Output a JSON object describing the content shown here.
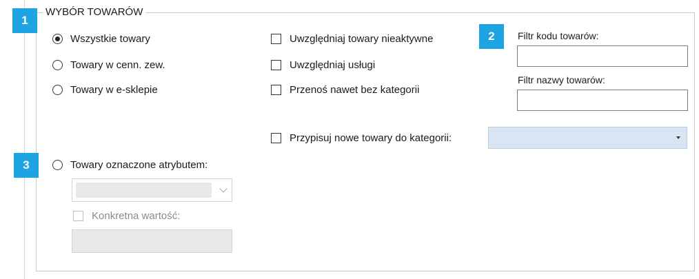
{
  "group_title": "WYBÓR TOWARÓW",
  "badges": [
    "1",
    "2",
    "3"
  ],
  "radios": [
    {
      "label": "Wszystkie towary",
      "checked": true
    },
    {
      "label": "Towary w cenn. zew.",
      "checked": false
    },
    {
      "label": "Towary w e-sklepie",
      "checked": false
    },
    {
      "label": "Towary oznaczone atrybutem:",
      "checked": false
    }
  ],
  "checkboxes": [
    {
      "label": "Uwzględniaj towary nieaktywne",
      "checked": false
    },
    {
      "label": "Uwzględniaj usługi",
      "checked": false
    },
    {
      "label": "Przenoś nawet bez kategorii",
      "checked": false
    },
    {
      "label": "Przypisuj nowe towary do kategorii:",
      "checked": false
    }
  ],
  "filters": {
    "code_label": "Filtr kodu towarów:",
    "code_value": "",
    "name_label": "Filtr nazwy towarów:",
    "name_value": ""
  },
  "category_combo": {
    "value": ""
  },
  "attribute": {
    "combo_value": "",
    "specific_value_label": "Konkretna wartość:",
    "specific_value": ""
  },
  "colors": {
    "badge": "#1ea3e3",
    "combo_bg": "#d9e5f2"
  }
}
